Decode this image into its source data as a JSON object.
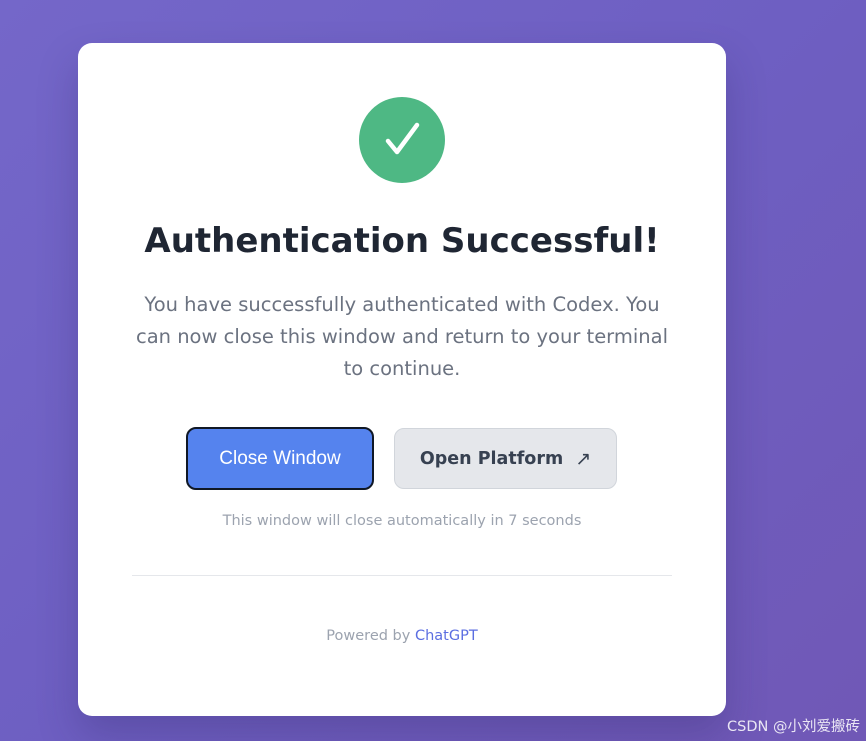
{
  "card": {
    "title": "Authentication Successful!",
    "message": "You have successfully authenticated with Codex. You can now close this window and return to your terminal to continue.",
    "icon": "checkmark-icon",
    "success_color": "#4eb884"
  },
  "buttons": {
    "close_label": "Close Window",
    "platform_label": "Open Platform",
    "platform_icon": "external-arrow-icon",
    "platform_arrow": "↗",
    "primary_color": "#5583ee"
  },
  "countdown_text": "This window will close automatically in 7 seconds",
  "footer": {
    "prefix": "Powered by",
    "link_text": "ChatGPT",
    "link_color": "#5b6ee1"
  },
  "watermark": "CSDN @小刘爱搬砖"
}
